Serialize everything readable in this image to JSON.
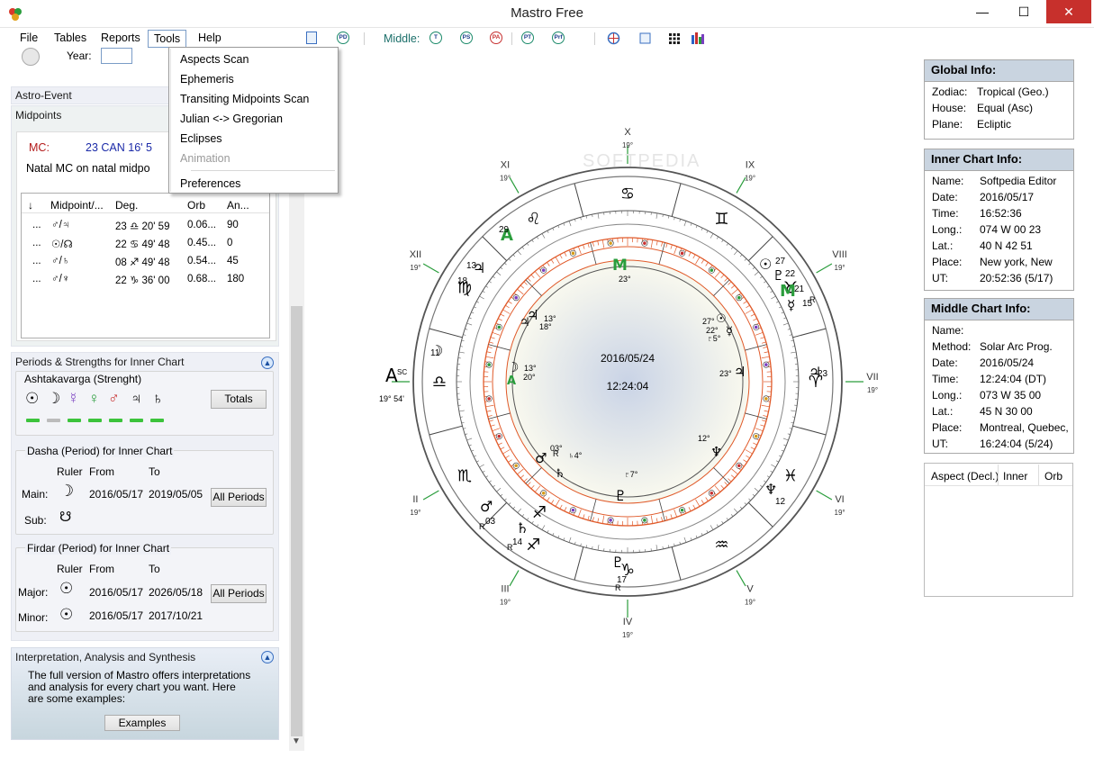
{
  "window": {
    "title": "Mastro Free",
    "minimize": "—",
    "maximize": "☐",
    "close": "✕"
  },
  "menu": {
    "file": "File",
    "tables": "Tables",
    "reports": "Reports",
    "tools": "Tools",
    "help": "Help"
  },
  "toolbar": {
    "middle_label": "Middle:",
    "icons": [
      "PD",
      "T",
      "PS",
      "PA",
      "PT",
      "Prf"
    ]
  },
  "tools_menu": {
    "items": [
      "Aspects Scan",
      "Ephemeris",
      "Transiting Midpoints Scan",
      "Julian <-> Gregorian",
      "Eclipses",
      "Animation",
      "Preferences"
    ]
  },
  "left": {
    "year_label": "Year:",
    "astro_event": "Astro-Event",
    "midpoints": "Midpoints",
    "mc_label": "MC:",
    "mc_value": "23 CAN 16' 5",
    "mc_desc": "Natal MC on natal midpo",
    "table": {
      "headers": [
        "↓",
        "Midpoint/...",
        "Deg.",
        "Orb",
        "An..."
      ],
      "rows": [
        [
          "...",
          "♂/♃",
          "23 ♎ 20' 59",
          "0.06...",
          "90"
        ],
        [
          "...",
          "☉/☊",
          "22 ♋ 49' 48",
          "0.45...",
          "0"
        ],
        [
          "...",
          "♂/♄",
          "08 ♐ 49' 48",
          "0.54...",
          "45"
        ],
        [
          "...",
          "♂/♆",
          "22 ♑ 36' 00",
          "0.68...",
          "180"
        ]
      ]
    },
    "periods_title": "Periods & Strengths  for Inner Chart",
    "ashtakavarga": "Ashtakavarga  (Strenght)",
    "totals": "Totals",
    "dasha_title": "Dasha (Period) for Inner Chart",
    "ruler": "Ruler",
    "from": "From",
    "to": "To",
    "main": "Main:",
    "sub": "Sub:",
    "dasha_main_from": "2016/05/17",
    "dasha_main_to": "2019/05/05",
    "all_periods": "All Periods",
    "firdar_title": "Firdar (Period)  for Inner Chart",
    "major": "Major:",
    "minor": "Minor:",
    "firdar_major_from": "2016/05/17",
    "firdar_major_to": "2026/05/18",
    "firdar_minor_from": "2016/05/17",
    "firdar_minor_to": "2017/10/21",
    "interp_title": "Interpretation, Analysis and Synthesis",
    "interp_text": "The full version of Mastro offers interpretations and analysis for every chart you want. Here are some examples:",
    "examples": "Examples"
  },
  "chart": {
    "center_date": "2016/05/24",
    "center_time": "12:24:04",
    "houses": [
      "X",
      "XI",
      "XII",
      "ASC",
      "II",
      "III",
      "IV",
      "V",
      "VI",
      "VII",
      "VIII",
      "IX"
    ],
    "house_deg": "19°",
    "asc_deg": "19° 54'",
    "watermark": "SOFTPEDIA"
  },
  "global_info": {
    "title": "Global Info:",
    "rows": [
      [
        "Zodiac:",
        "Tropical (Geo.)"
      ],
      [
        "House:",
        "Equal (Asc)"
      ],
      [
        "Plane:",
        "Ecliptic"
      ]
    ]
  },
  "inner_info": {
    "title": "Inner Chart Info:",
    "rows": [
      [
        "Name:",
        "Softpedia Editor"
      ],
      [
        "Date:",
        "2016/05/17"
      ],
      [
        "Time:",
        "16:52:36"
      ],
      [
        "Long.:",
        "074 W 00 23"
      ],
      [
        "Lat.:",
        "40 N 42 51"
      ],
      [
        "Place:",
        "New york, New"
      ],
      [
        "UT:",
        "20:52:36 (5/17)"
      ]
    ]
  },
  "middle_info": {
    "title": "Middle Chart Info:",
    "rows": [
      [
        "Name:",
        ""
      ],
      [
        "Method:",
        "Solar Arc Prog."
      ],
      [
        "Date:",
        "2016/05/24"
      ],
      [
        "Time:",
        "12:24:04  (DT)"
      ],
      [
        "Long.:",
        "073 W 35 00"
      ],
      [
        "Lat.:",
        "45 N 30 00"
      ],
      [
        "Place:",
        "Montreal, Quebec,"
      ],
      [
        "UT:",
        "16:24:04 (5/24)"
      ]
    ]
  },
  "aspect_table": {
    "headers": [
      "Aspect (Decl.)",
      "Inner",
      "Orb"
    ]
  }
}
